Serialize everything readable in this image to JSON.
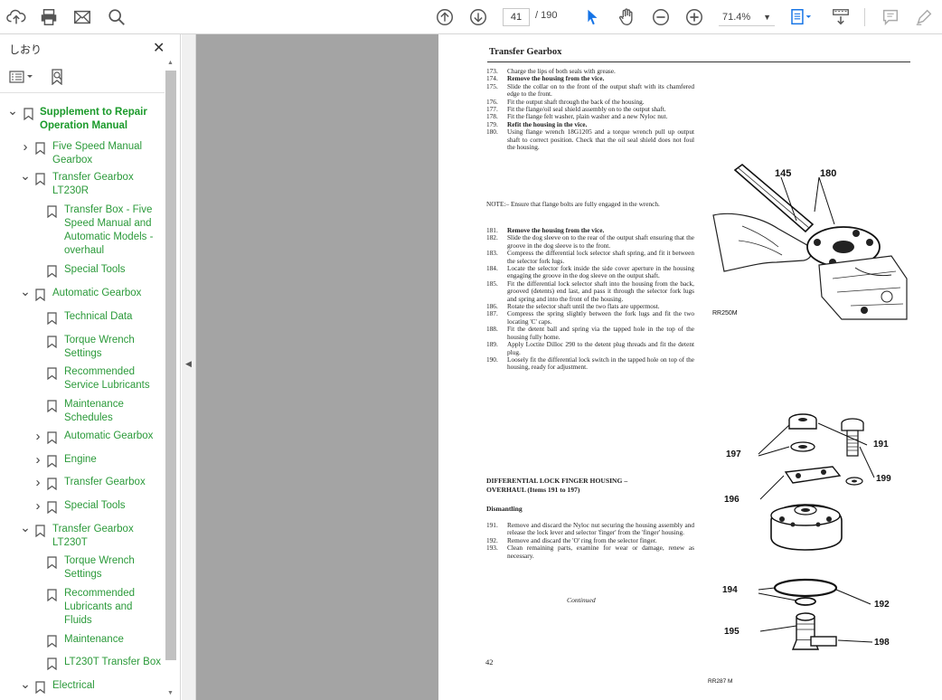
{
  "toolbar": {
    "page_current": "41",
    "page_total": "/ 190",
    "zoom": "71.4%"
  },
  "sidebar": {
    "title": "しおり",
    "close": "✕",
    "tree": [
      {
        "label": "Supplement to Repair Operation Manual",
        "line1": "Supplement to Repair",
        "line2": "Operation Manual",
        "bold": true
      },
      {
        "line1": "Five Speed Manual",
        "line2": "Gearbox"
      },
      {
        "line1": "Transfer Gearbox",
        "line2": "LT230R"
      },
      {
        "line1": "Transfer Box - Five",
        "line2": "Speed Manual and",
        "line3": "Automatic Models -",
        "line4": "overhaul"
      },
      {
        "line1": "Special Tools"
      },
      {
        "line1": "Automatic Gearbox"
      },
      {
        "line1": "Technical Data"
      },
      {
        "line1": "Torque Wrench",
        "line2": "Settings"
      },
      {
        "line1": "Recommended",
        "line2": "Service Lubricants"
      },
      {
        "line1": "Maintenance",
        "line2": "Schedules"
      },
      {
        "line1": "Automatic Gearbox"
      },
      {
        "line1": "Engine"
      },
      {
        "line1": "Transfer Gearbox"
      },
      {
        "line1": "Special Tools"
      },
      {
        "line1": "Transfer Gearbox",
        "line2": "LT230T"
      },
      {
        "line1": "Torque Wrench",
        "line2": "Settings"
      },
      {
        "line1": "Recommended",
        "line2": "Lubricants and",
        "line3": "Fluids"
      },
      {
        "line1": "Maintenance"
      },
      {
        "line1": "LT230T Transfer Box"
      },
      {
        "line1": "Electrical"
      }
    ]
  },
  "document": {
    "header": "Transfer Gearbox",
    "steps_a": [
      {
        "num": "173.",
        "text": "Charge the lips of both seals with grease."
      },
      {
        "num": "174.",
        "text": "Remove the housing from the vice.",
        "bold": true
      },
      {
        "num": "175.",
        "text": "Slide the collar on to the front of the output shaft with its chamfered edge to the front."
      },
      {
        "num": "176.",
        "text": "Fit the output shaft through the back of the housing."
      },
      {
        "num": "177.",
        "text": "Fit the flange/oil seal shield assembly on to the output shaft."
      },
      {
        "num": "178.",
        "text": "Fit the flange felt washer, plain washer and a new Nyloc nut."
      },
      {
        "num": "179.",
        "text": "Refit the housing in the vice.",
        "bold": true
      },
      {
        "num": "180.",
        "text": "Using flange wrench 18G1205 and a torque wrench pull up output shaft to correct position. Check that the oil seal shield does not foul the housing."
      }
    ],
    "note": "NOTE:– Ensure that flange bolts are fully engaged in the wrench.",
    "steps_b": [
      {
        "num": "181.",
        "text": "Remove the housing from the vice.",
        "bold": true
      },
      {
        "num": "182.",
        "text": "Slide the dog sleeve on to the rear of the output shaft ensuring that the groove in the dog sleeve is to the front."
      },
      {
        "num": "183.",
        "text": "Compress the differential lock selector shaft spring, and fit it between the selector fork lugs."
      },
      {
        "num": "184.",
        "text": "Locate the selector fork inside the side cover aperture in the housing engaging the groove in the dog sleeve on the output shaft."
      },
      {
        "num": "185.",
        "text": "Fit the differential lock selector shaft into the housing from the back, grooved (detents) end last, and pass it through the selector fork lugs and spring and into the front of the housing."
      },
      {
        "num": "186.",
        "text": "Rotate the selector shaft until the two flats are uppermost."
      },
      {
        "num": "187.",
        "text": "Compress the spring slightly between the fork lugs and fit the two locating 'C' caps."
      },
      {
        "num": "188.",
        "text": "Fit the detent ball and spring via the tapped hole in the top of the housing fully home."
      },
      {
        "num": "189.",
        "text": "Apply Loctite Dilloc 290 to the detent plug threads and fit the detent plug."
      },
      {
        "num": "190.",
        "text": "Loosely fit the differential lock switch in the tapped hole on top of the housing, ready for adjustment."
      }
    ],
    "diff_title_1": "DIFFERENTIAL LOCK FINGER HOUSING –",
    "diff_title_2": "OVERHAUL (Items 191 to 197)",
    "dismantling": "Dismantling",
    "steps_c": [
      {
        "num": "191.",
        "text": "Remove and discard the Nyloc nut securing the housing assembly and release the lock lever and selector 'finger' from the 'finger' housing."
      },
      {
        "num": "192.",
        "text": "Remove and discard the 'O' ring from the selector finger."
      },
      {
        "num": "193.",
        "text": "Clean remaining parts, examine for wear or damage, renew as necessary."
      }
    ],
    "continued": "Continued",
    "page_number": "42",
    "figure1": {
      "label_a": "145",
      "label_b": "180",
      "caption": "RR250M"
    },
    "figure2": {
      "labels": [
        "191",
        "197",
        "199",
        "196",
        "194",
        "192",
        "195",
        "198"
      ],
      "caption": "RR287 M"
    }
  }
}
